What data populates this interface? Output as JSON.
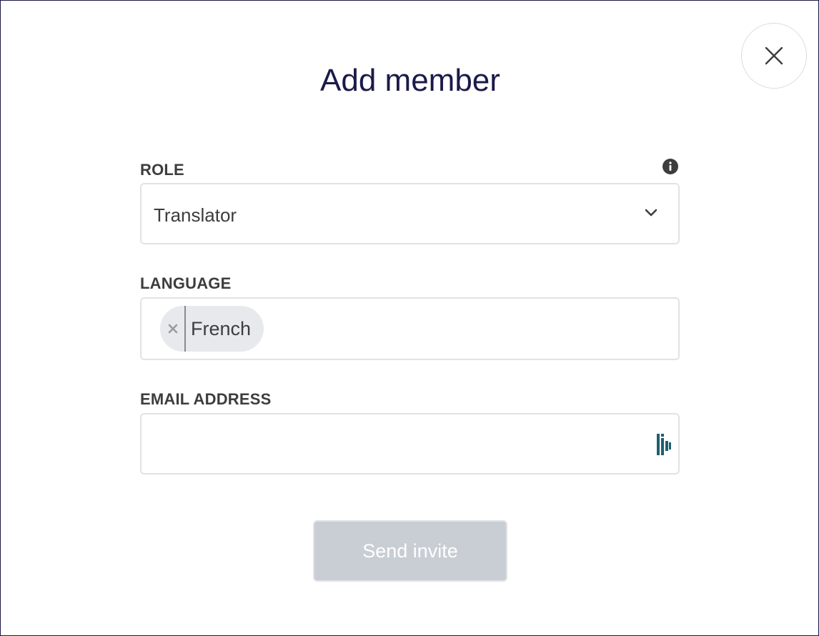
{
  "modal": {
    "title": "Add member",
    "close_icon": "close-icon"
  },
  "role": {
    "label": "ROLE",
    "value": "Translator",
    "info_icon": "info-icon",
    "dropdown_icon": "chevron-down-icon"
  },
  "language": {
    "label": "LANGUAGE",
    "chips": [
      {
        "label": "French",
        "remove_icon": "close-icon"
      }
    ]
  },
  "email": {
    "label": "EMAIL ADDRESS",
    "value": "",
    "placeholder": "",
    "addon_icon": "password-manager-icon"
  },
  "actions": {
    "send_label": "Send invite",
    "send_disabled": true
  },
  "colors": {
    "title": "#1b1a4a",
    "label": "#3d3d40",
    "border": "#e2e2e6",
    "chip_bg": "#e8e9ed",
    "button_disabled_bg": "#c9ced5",
    "addon_icon": "#1f5f6e"
  }
}
